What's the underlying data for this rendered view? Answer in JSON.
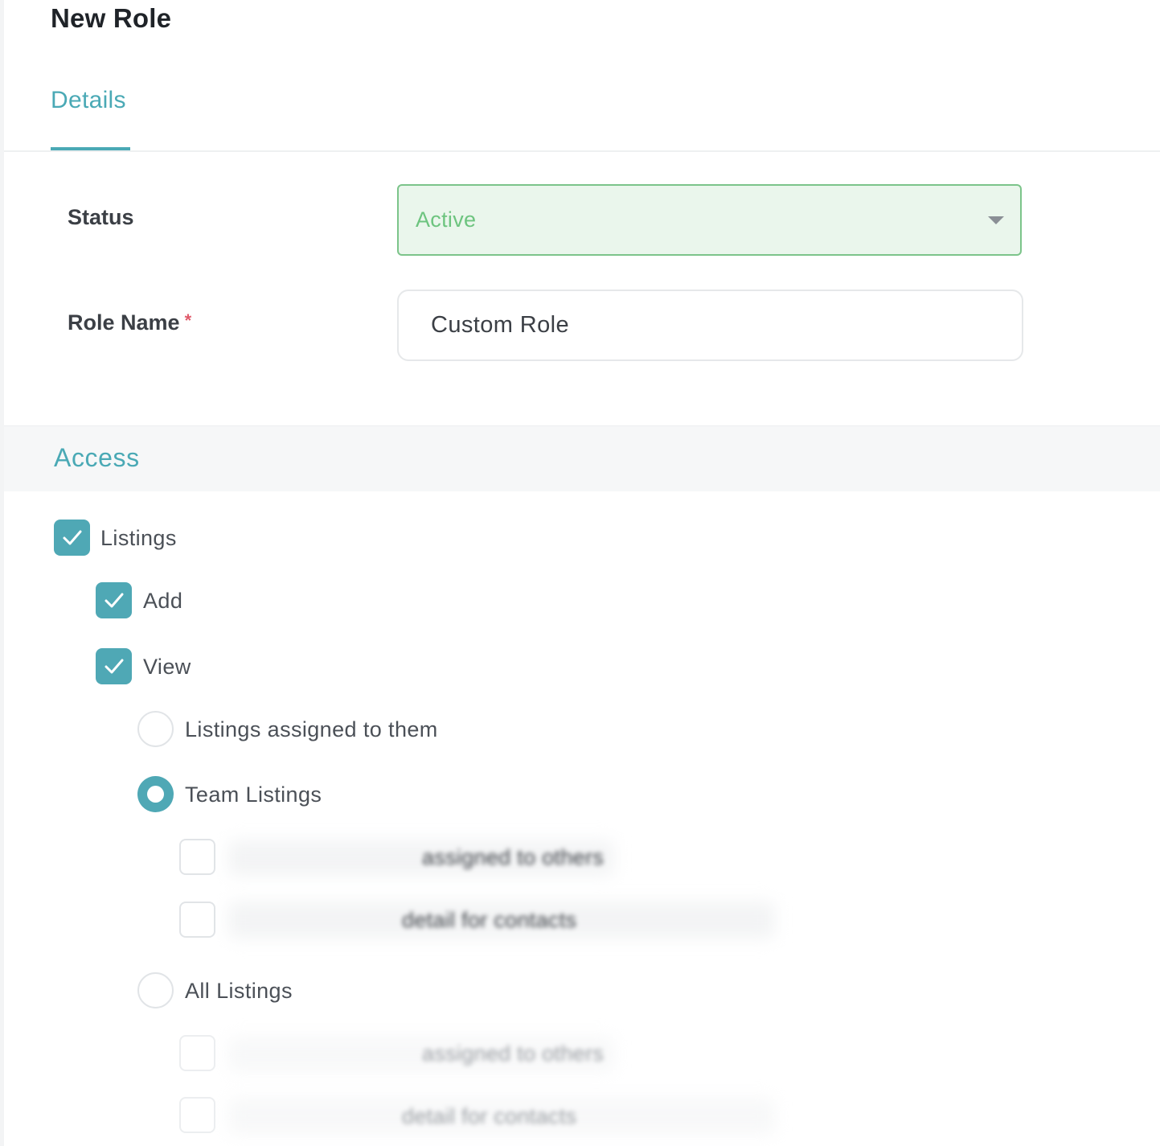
{
  "page": {
    "title": "New Role"
  },
  "tabs": [
    {
      "label": "Details",
      "active": true
    }
  ],
  "form": {
    "status": {
      "label": "Status",
      "value": "Active",
      "icon": "chevron-down-icon"
    },
    "role_name": {
      "label": "Role Name",
      "required_mark": "*",
      "value": "Custom Role"
    }
  },
  "access": {
    "title": "Access",
    "listings": {
      "label": "Listings",
      "checked": true,
      "add": {
        "label": "Add",
        "checked": true
      },
      "view": {
        "label": "View",
        "checked": true,
        "options": [
          {
            "label": "Listings assigned to them",
            "selected": false
          },
          {
            "label": "Team Listings",
            "selected": true,
            "sub_options": [
              {
                "label": "assigned to others",
                "checked": false
              },
              {
                "label": "detail for contacts",
                "checked": false
              }
            ]
          },
          {
            "label": "All Listings",
            "selected": false,
            "sub_options": [
              {
                "label": "assigned to others",
                "checked": false
              },
              {
                "label": "detail for contacts",
                "checked": false
              }
            ]
          }
        ]
      }
    }
  },
  "colors": {
    "accent": "#4aa9b5",
    "status_active_bg": "#eaf6ec",
    "status_active_border": "#7cc48a",
    "required": "#e05a6a"
  }
}
